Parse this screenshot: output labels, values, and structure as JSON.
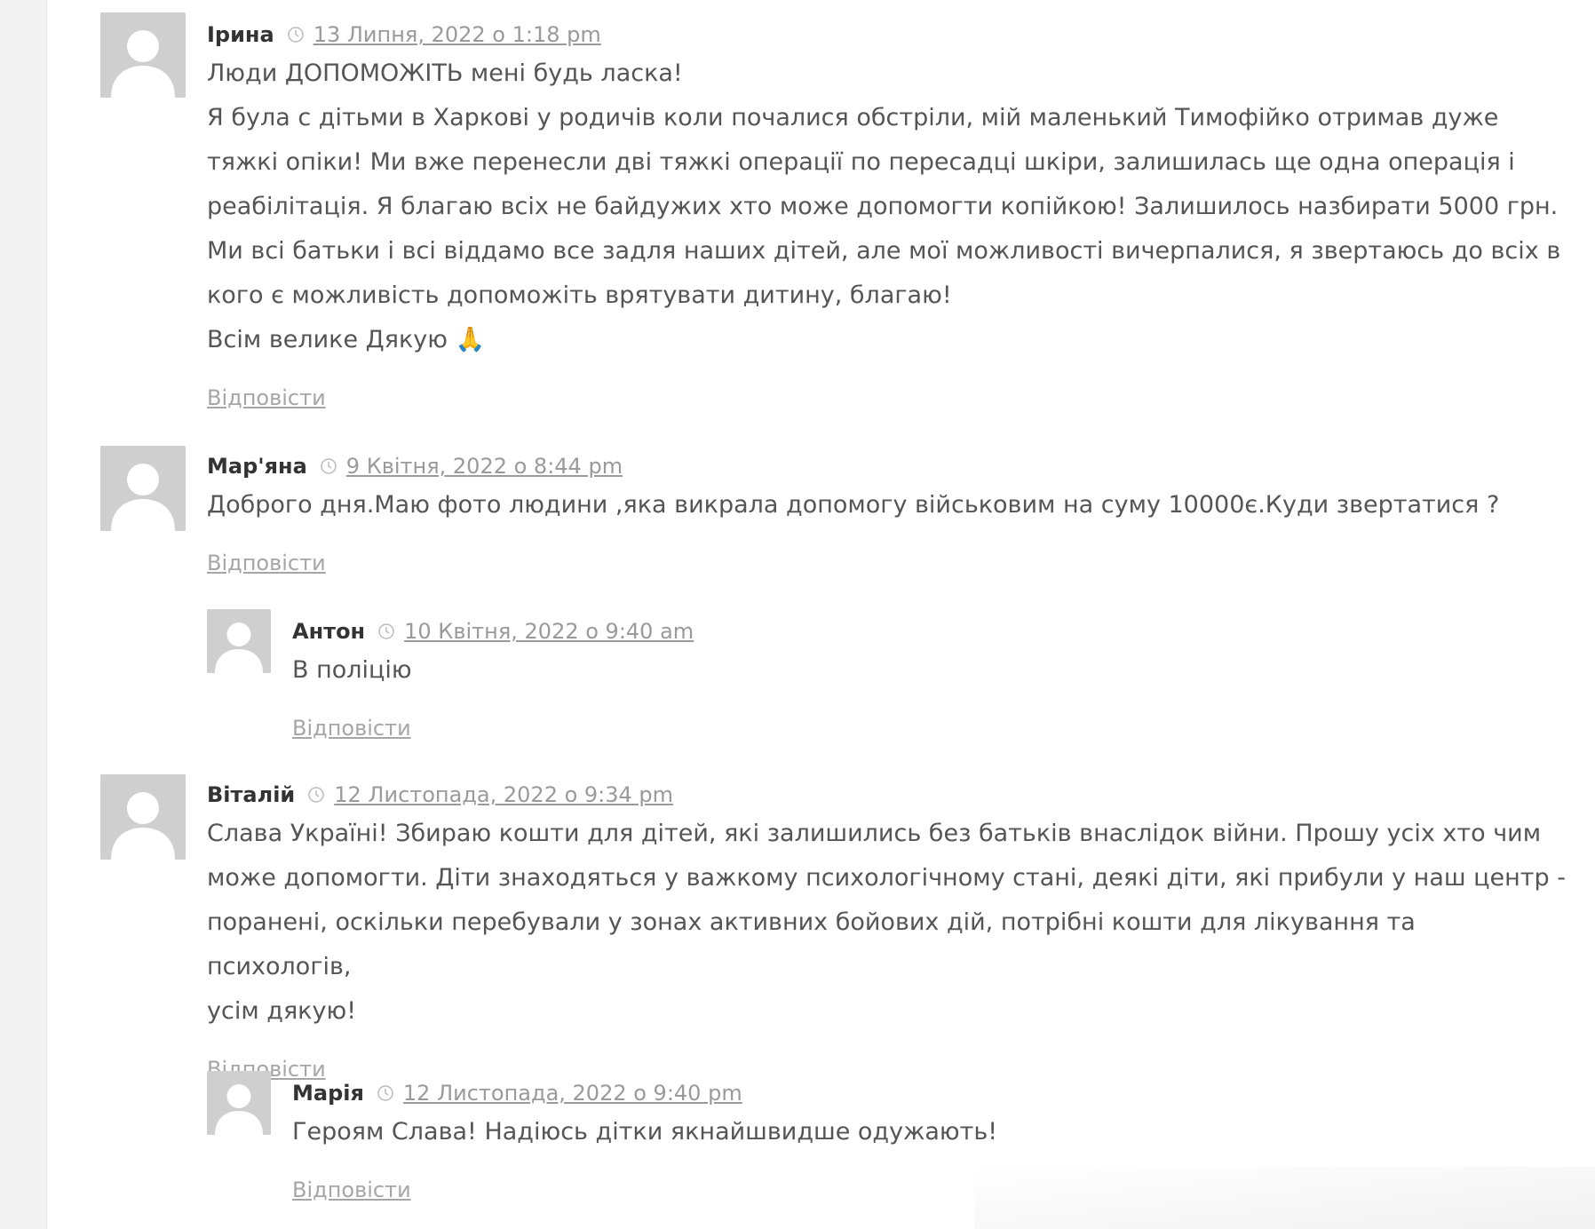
{
  "comments": [
    {
      "author": "Ірина",
      "date": "13 Липня, 2022 о 1:18 pm",
      "lines": [
        "Люди ДОПОМОЖІТЬ мені будь ласка!",
        "Я була с дітьми в Харкові у родичів коли почалися обстріли, мій маленький Тимофійко отримав дуже",
        "тяжкі опіки! Ми вже перенесли дві тяжкі операції по пересадці шкіри, залишилась ще одна операція і",
        "реабілітація. Я благаю всіх не байдужих хто може допомогти копійкою! Залишилось назбирати 5000 грн.",
        "Ми всі батьки і всі віддамо все задля наших дітей, але мої можливості вичерпалися, я звертаюсь до всіх в",
        "кого є можливість допоможіть врятувати дитину, благаю!",
        "Всім велике Дякую 🙏"
      ],
      "reply_label": "Відповісти"
    },
    {
      "author": "Мар'яна",
      "date": "9 Квітня, 2022 о 8:44 pm",
      "lines": [
        "Доброго дня.Маю фото людини ,яка викрала допомогу військовим на суму 10000є.Куди звертатися ?"
      ],
      "reply_label": "Відповісти"
    },
    {
      "author": "Антон",
      "date": "10 Квітня, 2022 о 9:40 am",
      "lines": [
        "В поліцію"
      ],
      "reply_label": "Відповісти"
    },
    {
      "author": "Віталій",
      "date": "12 Листопада, 2022 о 9:34 pm",
      "lines": [
        "Слава Україні! Збираю кошти для дітей, які залишились без батьків внаслідок війни. Прошу усіх хто чим",
        "може допомогти. Діти знаходяться у важкому психологічному стані, деякі діти, які прибули у наш центр -",
        "поранені, оскільки перебували у зонах активних бойових дій, потрібні кошти для лікування та психологів,",
        "усім дякую!"
      ],
      "reply_label": "Відповісти"
    },
    {
      "author": "Марія",
      "date": "12 Листопада, 2022 о 9:40 pm",
      "lines": [
        "Героям Слава! Надіюсь дітки якнайшвидше одужають!"
      ],
      "reply_label": "Відповісти"
    }
  ]
}
